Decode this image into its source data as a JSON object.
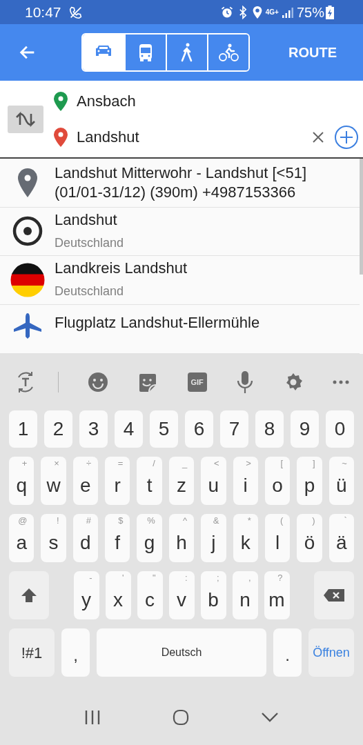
{
  "status_bar": {
    "time": "10:47",
    "network": "4G+",
    "battery": "75%"
  },
  "toolbar": {
    "modes": [
      {
        "kind": "car",
        "selected": true
      },
      {
        "kind": "bus",
        "selected": false
      },
      {
        "kind": "walk",
        "selected": false
      },
      {
        "kind": "bike",
        "selected": false
      }
    ],
    "action": "ROUTE"
  },
  "route": {
    "from": "Ansbach",
    "to": "Landshut"
  },
  "results": [
    {
      "kind": "pin",
      "title": "Landshut Mitterwohr - Landshut [<51] (01/01-31/12)  (390m) +4987153366"
    },
    {
      "kind": "target",
      "title": "Landshut",
      "subtitle": "Deutschland"
    },
    {
      "kind": "flag",
      "title": "Landkreis Landshut",
      "subtitle": "Deutschland"
    },
    {
      "kind": "plane",
      "title": "Flugplatz Landshut-Ellermühle"
    }
  ],
  "keyboard_toolbar": {
    "gif": "GIF"
  },
  "keyboard": {
    "number_row": [
      {
        "label": "1"
      },
      {
        "label": "2"
      },
      {
        "label": "3"
      },
      {
        "label": "4"
      },
      {
        "label": "5"
      },
      {
        "label": "6"
      },
      {
        "label": "7"
      },
      {
        "label": "8"
      },
      {
        "label": "9"
      },
      {
        "label": "0"
      }
    ],
    "top_letter_row": [
      {
        "label": "q",
        "hint": "+"
      },
      {
        "label": "w",
        "hint": "×"
      },
      {
        "label": "e",
        "hint": "÷"
      },
      {
        "label": "r",
        "hint": "="
      },
      {
        "label": "t",
        "hint": "/"
      },
      {
        "label": "z",
        "hint": "_"
      },
      {
        "label": "u",
        "hint": "<"
      },
      {
        "label": "i",
        "hint": ">"
      },
      {
        "label": "o",
        "hint": "["
      },
      {
        "label": "p",
        "hint": "]"
      },
      {
        "label": "ü",
        "hint": "~"
      }
    ],
    "middle_letter_row": [
      {
        "label": "a",
        "hint": "@"
      },
      {
        "label": "s",
        "hint": "!"
      },
      {
        "label": "d",
        "hint": "#"
      },
      {
        "label": "f",
        "hint": "$"
      },
      {
        "label": "g",
        "hint": "%"
      },
      {
        "label": "h",
        "hint": "^"
      },
      {
        "label": "j",
        "hint": "&"
      },
      {
        "label": "k",
        "hint": "*"
      },
      {
        "label": "l",
        "hint": "("
      },
      {
        "label": "ö",
        "hint": ")"
      },
      {
        "label": "ä",
        "hint": "`"
      }
    ],
    "bottom_letter_row": [
      {
        "kind": "shift"
      },
      {
        "label": "y",
        "hint": "-"
      },
      {
        "label": "x",
        "hint": "'"
      },
      {
        "label": "c",
        "hint": "\""
      },
      {
        "label": "v",
        "hint": ":"
      },
      {
        "label": "b",
        "hint": ";"
      },
      {
        "label": "n",
        "hint": ","
      },
      {
        "label": "m",
        "hint": "?"
      },
      {
        "kind": "backspace"
      }
    ],
    "function_row": [
      {
        "kind": "symbols",
        "label": "!#1"
      },
      {
        "kind": "char",
        "label": ","
      },
      {
        "kind": "space",
        "label": "Deutsch"
      },
      {
        "kind": "char",
        "label": "."
      },
      {
        "kind": "action",
        "label": "Öffnen"
      }
    ]
  }
}
